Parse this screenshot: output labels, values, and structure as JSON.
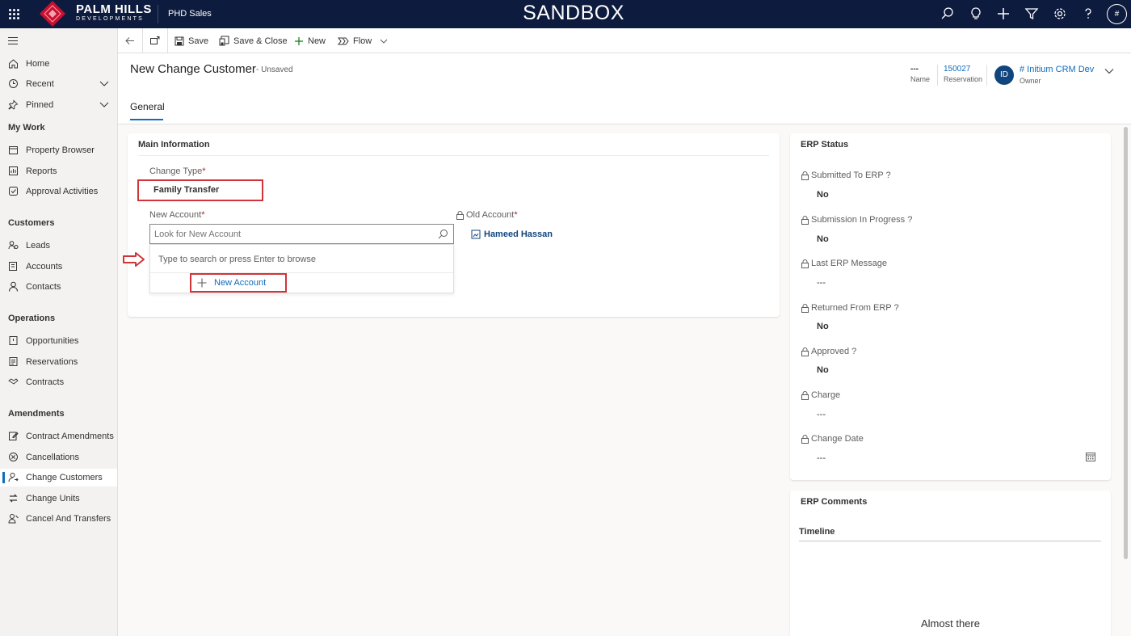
{
  "topbar": {
    "brand_name": "PALM HILLS",
    "brand_sub": "DEVELOPMENTS",
    "app_name": "PHD Sales",
    "env_label": "SANDBOX",
    "user_initials": "#",
    "icons": [
      "search-icon",
      "lightbulb-icon",
      "plus-icon",
      "filter-icon",
      "gear-icon",
      "help-icon"
    ]
  },
  "sidebar": {
    "top_items": [
      {
        "label": "Home",
        "icon": "home-icon"
      },
      {
        "label": "Recent",
        "icon": "clock-icon"
      },
      {
        "label": "Pinned",
        "icon": "pin-icon"
      }
    ],
    "groups": [
      {
        "title": "My Work",
        "items": [
          {
            "label": "Property Browser",
            "icon": "calendar-icon"
          },
          {
            "label": "Reports",
            "icon": "report-icon"
          },
          {
            "label": "Approval Activities",
            "icon": "approval-icon"
          }
        ]
      },
      {
        "title": "Customers",
        "items": [
          {
            "label": "Leads",
            "icon": "leads-icon"
          },
          {
            "label": "Accounts",
            "icon": "accounts-icon"
          },
          {
            "label": "Contacts",
            "icon": "person-icon"
          }
        ]
      },
      {
        "title": "Operations",
        "items": [
          {
            "label": "Opportunities",
            "icon": "opportunity-icon"
          },
          {
            "label": "Reservations",
            "icon": "reservation-icon"
          },
          {
            "label": "Contracts",
            "icon": "handshake-icon"
          }
        ]
      },
      {
        "title": "Amendments",
        "items": [
          {
            "label": "Contract Amendments",
            "icon": "edit-icon"
          },
          {
            "label": "Cancellations",
            "icon": "cancel-icon"
          },
          {
            "label": "Change Customers",
            "icon": "change-customer-icon",
            "active": true
          },
          {
            "label": "Change Units",
            "icon": "swap-icon"
          },
          {
            "label": "Cancel And Transfers",
            "icon": "transfer-icon"
          }
        ]
      }
    ]
  },
  "command_bar": {
    "save": "Save",
    "save_close": "Save & Close",
    "new": "New",
    "flow": "Flow"
  },
  "header": {
    "title": "New Change Customer",
    "state": "- Unsaved",
    "fields": [
      {
        "value": "---",
        "label": "Name"
      },
      {
        "value": "150027",
        "label": "Reservation"
      }
    ],
    "owner": {
      "initials": "ID",
      "name": "# Initium CRM Dev",
      "label": "Owner"
    },
    "tab": "General"
  },
  "main_info": {
    "title": "Main Information",
    "change_type_label": "Change Type",
    "change_type_value": "Family Transfer",
    "new_account_label": "New Account",
    "new_account_placeholder": "Look for New Account",
    "old_account_label": "Old Account",
    "old_account_value": "Hameed Hassan",
    "flyout_hint": "Type to search or press Enter to browse",
    "flyout_new": "New Account",
    "required_mark": "*"
  },
  "erp_status": {
    "title": "ERP Status",
    "fields": [
      {
        "label": "Submitted To ERP ?",
        "value": "No"
      },
      {
        "label": "Submission In Progress ?",
        "value": "No"
      },
      {
        "label": "Last ERP Message",
        "value": "---"
      },
      {
        "label": "Returned From ERP ?",
        "value": "No"
      },
      {
        "label": "Approved ?",
        "value": "No"
      },
      {
        "label": "Charge",
        "value": "---"
      },
      {
        "label": "Change Date",
        "value": "---"
      }
    ]
  },
  "erp_comments": {
    "title": "ERP Comments",
    "timeline_label": "Timeline",
    "loading_text": "Almost there"
  },
  "colors": {
    "topbar": "#0d1b3e",
    "accent": "#0f6cbd",
    "highlight_red": "#d13438",
    "logo_red": "#c8102e"
  }
}
